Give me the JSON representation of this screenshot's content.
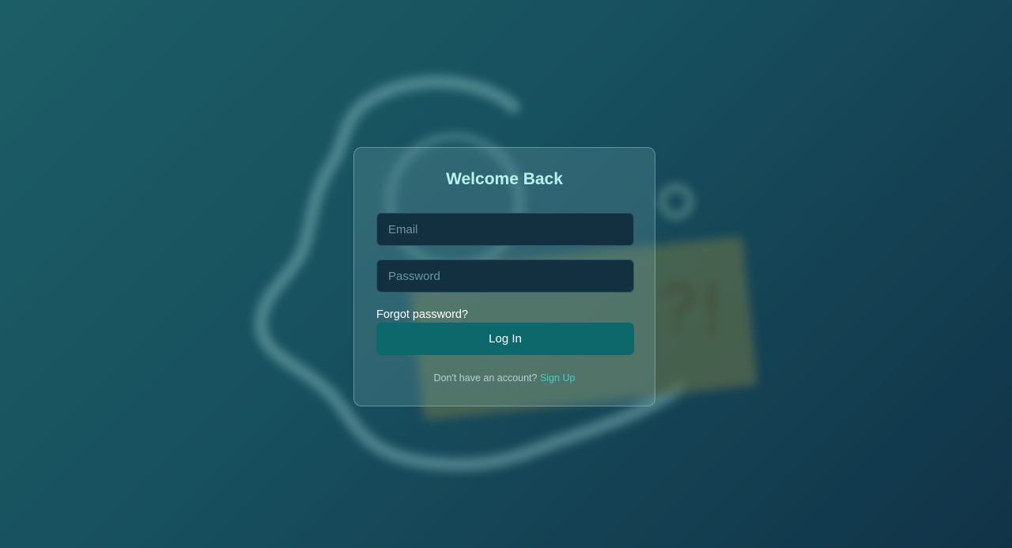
{
  "login": {
    "title": "Welcome Back",
    "email_placeholder": "Email",
    "password_placeholder": "Password",
    "forgot_label": "Forgot password?",
    "login_label": "Log In",
    "signup_prompt": "Don't have an account?",
    "signup_label": "Sign Up"
  },
  "colors": {
    "background_start": "#1c5e66",
    "background_end": "#113348",
    "title": "#b9f1ec",
    "input_bg": "#12303f",
    "button": "#0c686b",
    "link_accent": "#3fd3c3"
  }
}
